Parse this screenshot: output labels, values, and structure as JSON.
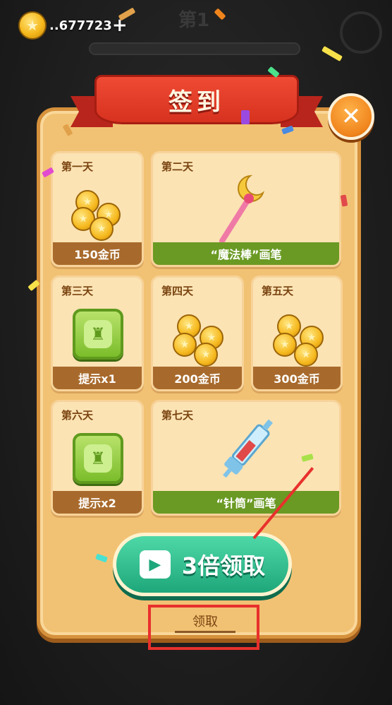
{
  "hud": {
    "coin_amount": "..677723",
    "plus": "+",
    "level_text": "第1"
  },
  "dialog": {
    "title": "签到",
    "close_symbol": "✕"
  },
  "days": [
    {
      "day": "第一天",
      "reward": "150金币"
    },
    {
      "day": "第二天",
      "reward": "“魔法棒”画笔"
    },
    {
      "day": "第三天",
      "reward": "提示x1"
    },
    {
      "day": "第四天",
      "reward": "200金币"
    },
    {
      "day": "第五天",
      "reward": "300金币"
    },
    {
      "day": "第六天",
      "reward": "提示x2"
    },
    {
      "day": "第七天",
      "reward": "“针筒”画笔"
    }
  ],
  "buttons": {
    "triple_claim": "3倍领取",
    "claim": "领取"
  },
  "colors": {
    "panel": "#f2c274",
    "ribbon": "#d7321f",
    "green_button": "#1ea77a",
    "highlight": "#e8302c"
  }
}
